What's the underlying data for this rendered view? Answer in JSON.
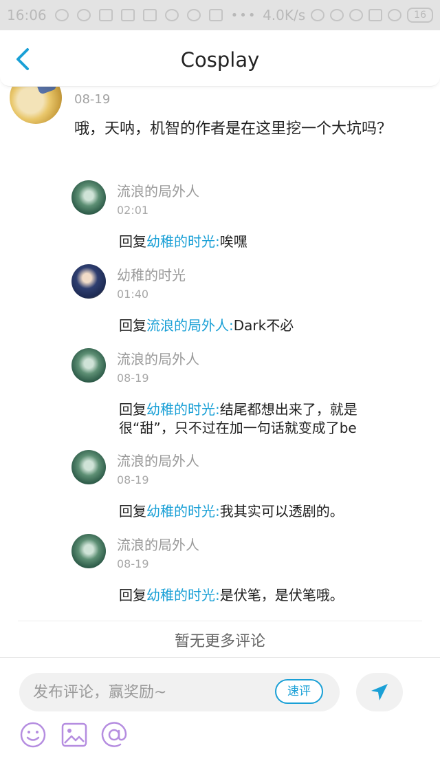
{
  "status_bar": {
    "time": "16:06",
    "network_speed": "4.0K/s",
    "battery": "16"
  },
  "header": {
    "title": "Cosplay",
    "back_icon": "chevron-left-icon"
  },
  "main_comment": {
    "date": "08-19",
    "text": "哦，天呐，机智的作者是在这里挖一个大坑吗？"
  },
  "replies": [
    {
      "name": "流浪的局外人",
      "date": "02:01",
      "prefix": "回复",
      "target": "幼稚的时光:",
      "body": "唉嘿"
    },
    {
      "name": "幼稚的时光",
      "date": "01:40",
      "prefix": "回复",
      "target": "流浪的局外人:",
      "body": "Dark不必"
    },
    {
      "name": "流浪的局外人",
      "date": "08-19",
      "prefix": "回复",
      "target": "幼稚的时光:",
      "body": "结尾都想出来了，就是很“甜”，只不过在加一句话就变成了be"
    },
    {
      "name": "流浪的局外人",
      "date": "08-19",
      "prefix": "回复",
      "target": "幼稚的时光:",
      "body": "我其实可以透剧的。"
    },
    {
      "name": "流浪的局外人",
      "date": "08-19",
      "prefix": "回复",
      "target": "幼稚的时光:",
      "body": "是伏笔，是伏笔哦。"
    }
  ],
  "no_more_text": "暂无更多评论",
  "footer": {
    "input_placeholder": "发布评论，赢奖励~",
    "quick_comment_label": "速评",
    "icons": [
      "emoji-icon",
      "image-icon",
      "mention-icon",
      "send-icon"
    ]
  },
  "colors": {
    "accent": "#1aa0d6",
    "tool_icon": "#b58de0"
  }
}
